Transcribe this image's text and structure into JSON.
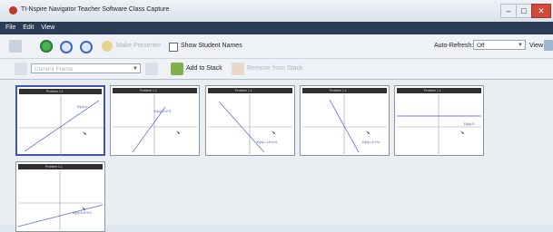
{
  "window": {
    "title": "TI-Nspire Navigator Teacher Software Class Capture",
    "controls": [
      "–",
      "□",
      "✕"
    ]
  },
  "menu": [
    "File",
    "Edit",
    "View"
  ],
  "toolbar": {
    "make_presenter": "Make Presenter",
    "show_student_names": "Show Student Names",
    "auto_refresh_label": "Auto-Refresh:",
    "auto_refresh_value": "Off",
    "view_label": "View"
  },
  "toolbar2": {
    "frame_select": "Current Frame",
    "add_to_stack": "Add to Stack",
    "remove_from_stack": "Remove from Stack"
  },
  "thumbnails": [
    {
      "header": "Problem 1.1",
      "label": "f1(x)=x"
    },
    {
      "header": "Problem 1.1",
      "label": "f1(x)=2·x+3"
    },
    {
      "header": "Problem 1.1",
      "label": "f1(x)=-1.5·x+3"
    },
    {
      "header": "Problem 1.1",
      "label": "f1(x)=-2·x+4"
    },
    {
      "header": "Problem 1.1",
      "label": "f1(x)=3"
    },
    {
      "header": "Problem 1.1",
      "label": "f1(x)=0.5·x+1"
    }
  ],
  "colors": {
    "menubar": "#2b3a55",
    "graph_line": "#6f7fd8",
    "selected_border": "#3f56b5",
    "refresh_button": "#4caf50"
  }
}
